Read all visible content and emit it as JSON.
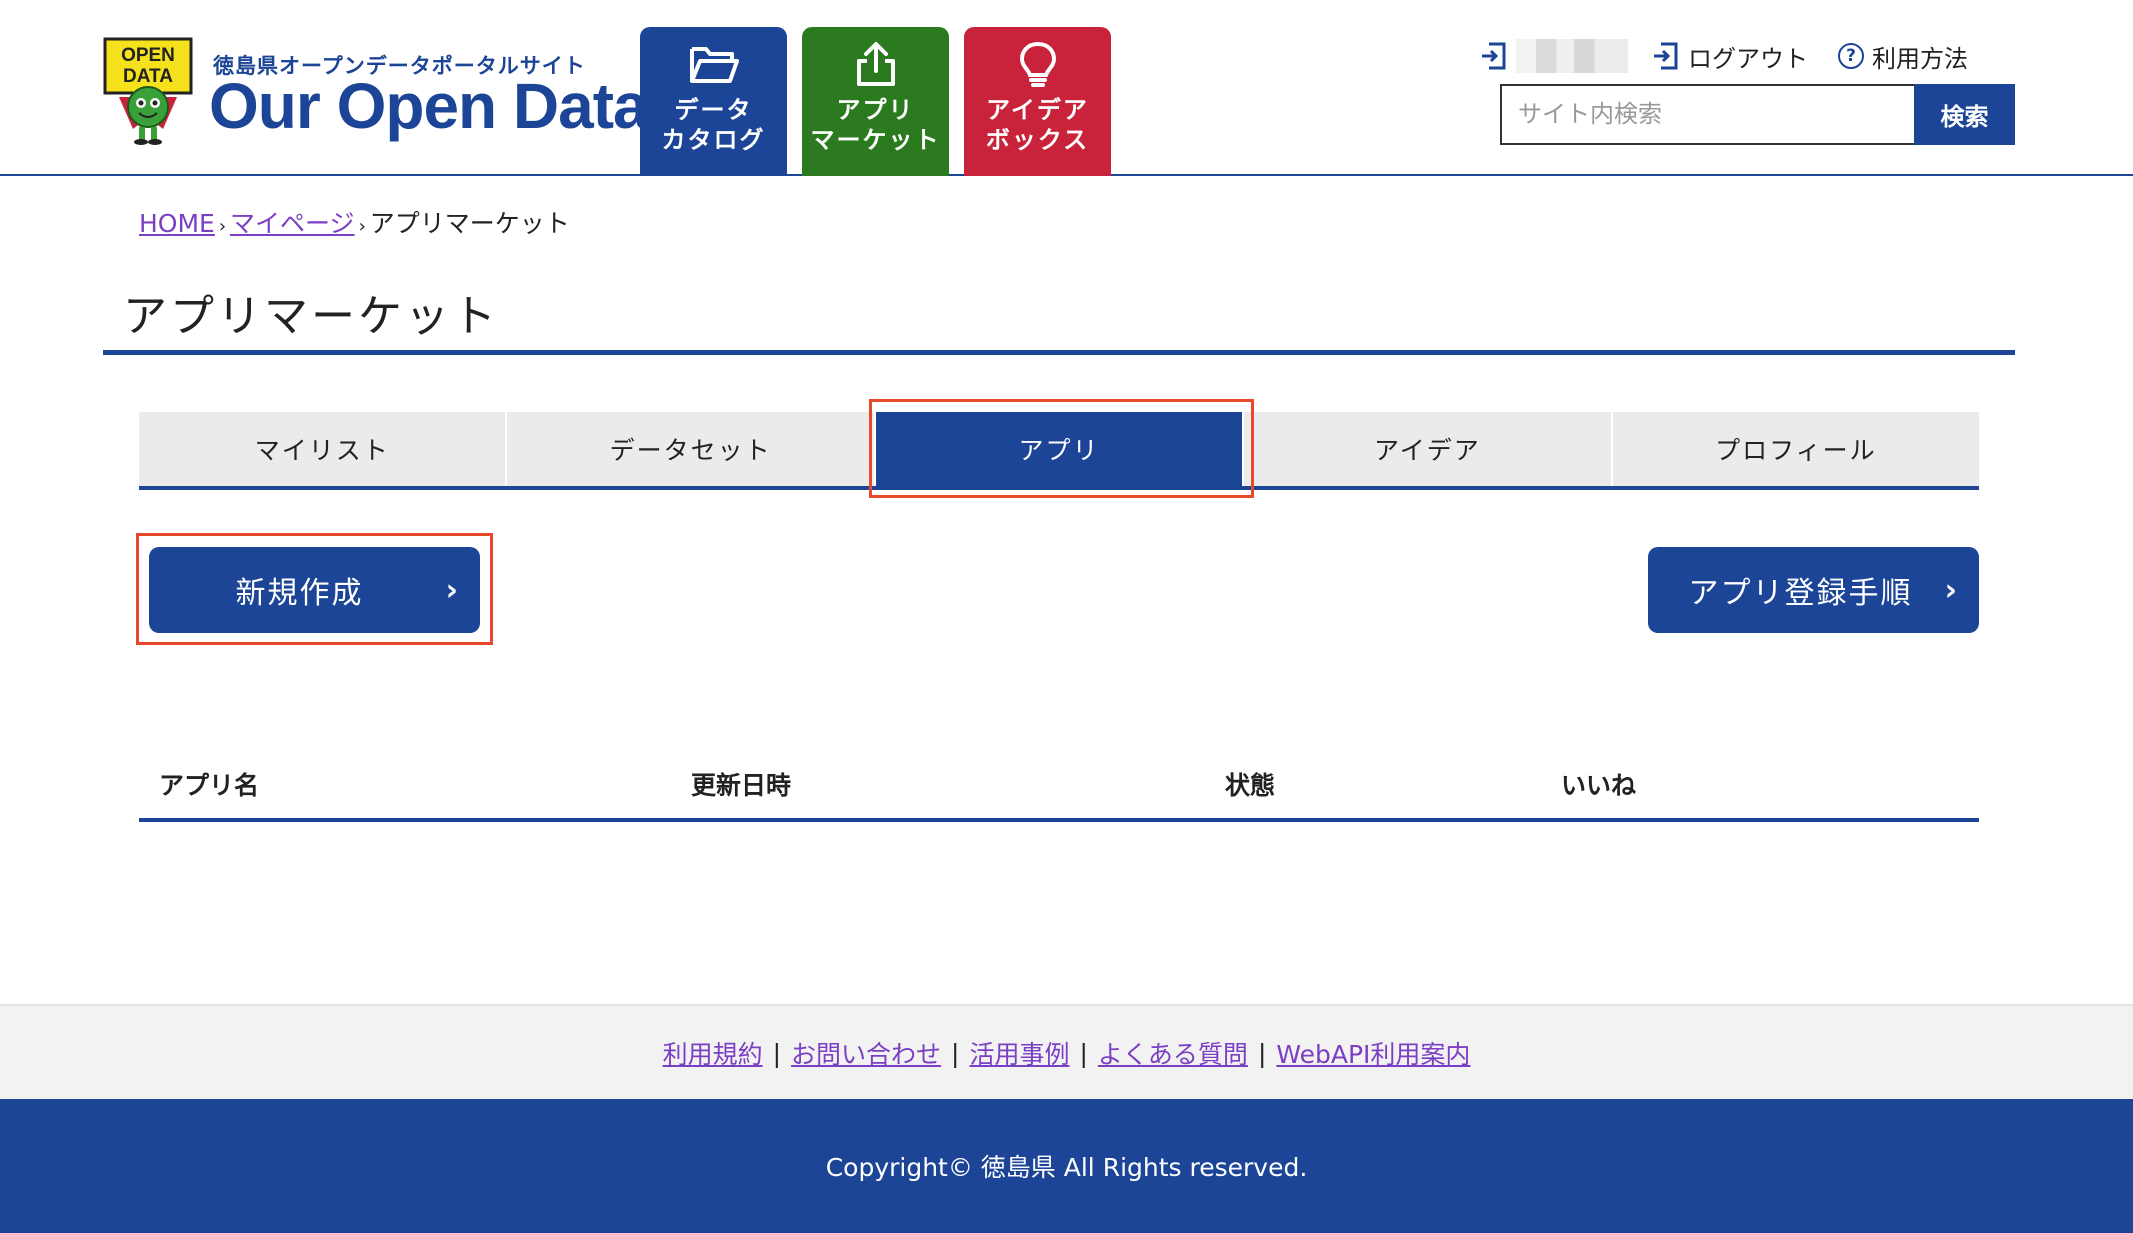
{
  "header": {
    "logo_badge_text": [
      "OPEN",
      "DATA"
    ],
    "site_subtitle": "徳島県オープンデータポータルサイト",
    "site_name": "Our Open Data",
    "nav": [
      {
        "label": "データ\nカタログ",
        "icon": "folder-open-icon",
        "color": "#1c4597"
      },
      {
        "label": "アプリ\nマーケット",
        "icon": "share-upload-icon",
        "color": "#2b7a1f"
      },
      {
        "label": "アイデア\nボックス",
        "icon": "lightbulb-icon",
        "color": "#c8233a"
      }
    ],
    "logout_label": "ログアウト",
    "help_label": "利用方法",
    "search_placeholder": "サイト内検索",
    "search_button": "検索"
  },
  "breadcrumb": {
    "home": "HOME",
    "mypage": "マイページ",
    "current": "アプリマーケット",
    "separator": "›"
  },
  "page_title": "アプリマーケット",
  "tabs": [
    {
      "label": "マイリスト",
      "active": false
    },
    {
      "label": "データセット",
      "active": false
    },
    {
      "label": "アプリ",
      "active": true
    },
    {
      "label": "アイデア",
      "active": false
    },
    {
      "label": "プロフィール",
      "active": false
    }
  ],
  "buttons": {
    "new": "新規作成",
    "guide": "アプリ登録手順",
    "chevron": "›"
  },
  "table": {
    "columns": [
      "アプリ名",
      "更新日時",
      "状態",
      "いいね"
    ]
  },
  "footer": {
    "links": [
      "利用規約",
      "お問い合わせ",
      "活用事例",
      "よくある質問",
      "WebAPI利用案内"
    ],
    "separator": "|",
    "copyright": "Copyright© 徳島県 All Rights reserved."
  },
  "colors": {
    "brand_blue": "#1c4597",
    "app_green": "#2b7a1f",
    "idea_red": "#c8233a",
    "highlight": "#e8482b",
    "link_purple": "#7b3fc4"
  }
}
